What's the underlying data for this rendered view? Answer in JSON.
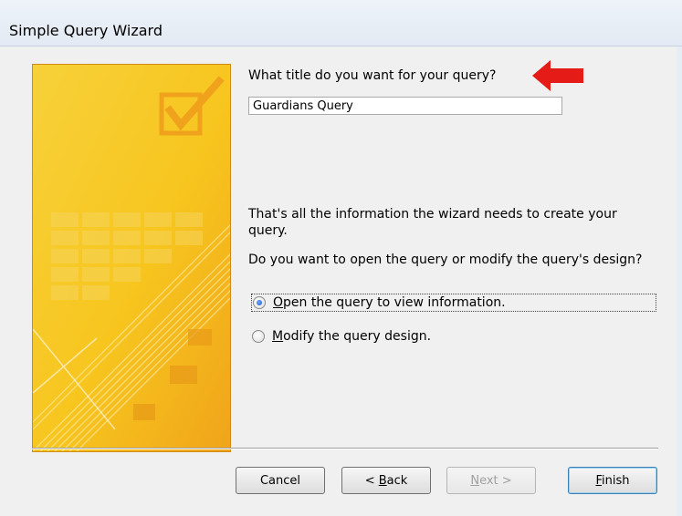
{
  "window": {
    "title": "Simple Query Wizard"
  },
  "form": {
    "title_question": "What title do you want for your query?",
    "title_value": "Guardians Query",
    "info_line": "That's all the information the wizard needs to create your query.",
    "open_or_modify_question": "Do you want to open the query or modify the query's design?",
    "options": [
      {
        "label": "Open the query to view information.",
        "mnemonic": "O",
        "rest": "pen the query to view information.",
        "selected": true
      },
      {
        "label": "Modify the query design.",
        "mnemonic": "M",
        "rest": "odify the query design.",
        "selected": false
      }
    ]
  },
  "buttons": {
    "cancel": "Cancel",
    "back_prefix": "< ",
    "back_mnemonic": "B",
    "back_rest": "ack",
    "next_mnemonic": "N",
    "next_rest": "ext >",
    "finish_mnemonic": "F",
    "finish_rest": "inish"
  },
  "icons": {
    "banner": "checkbox-banner-icon",
    "annotation": "red-arrow-icon"
  },
  "colors": {
    "banner_yellow": "#f7c51e",
    "banner_orange": "#f2a51c",
    "arrow_red": "#e41b17",
    "dialog_bg": "#f0f0f0"
  }
}
